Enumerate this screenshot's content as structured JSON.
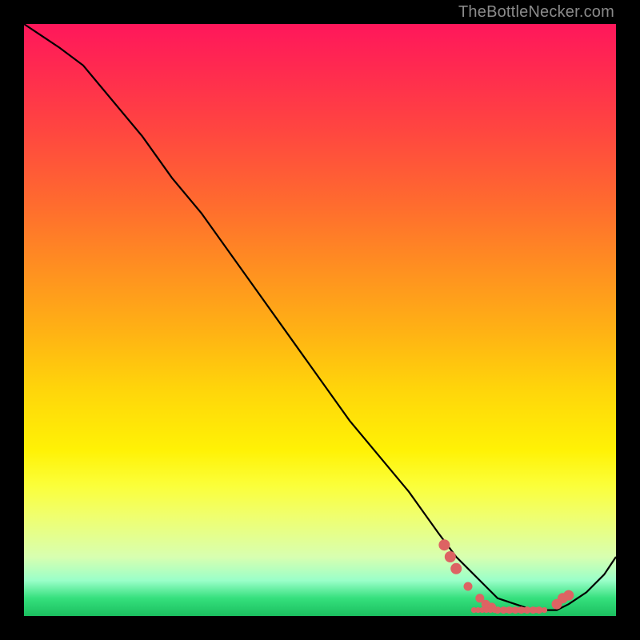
{
  "watermark": "TheBottleNecker.com",
  "chart_data": {
    "type": "line",
    "title": "",
    "xlabel": "",
    "ylabel": "",
    "xlim": [
      0,
      100
    ],
    "ylim": [
      0,
      100
    ],
    "grid": false,
    "series": [
      {
        "name": "curve",
        "x": [
          0,
          3,
          6,
          10,
          15,
          20,
          25,
          30,
          35,
          40,
          45,
          50,
          55,
          60,
          65,
          70,
          73,
          75,
          78,
          80,
          83,
          86,
          88,
          90,
          92,
          95,
          98,
          100
        ],
        "values": [
          100,
          98,
          96,
          93,
          87,
          81,
          74,
          68,
          61,
          54,
          47,
          40,
          33,
          27,
          21,
          14,
          10,
          8,
          5,
          3,
          2,
          1,
          1,
          1,
          2,
          4,
          7,
          10
        ]
      }
    ],
    "markers": {
      "name": "highlight-points",
      "x": [
        71,
        72,
        73,
        75,
        77,
        78,
        79,
        80,
        81,
        82,
        83,
        84,
        85,
        86,
        87,
        90,
        91,
        92
      ],
      "y": [
        12,
        10,
        8,
        5,
        3,
        2,
        1.5,
        1,
        1,
        1,
        1,
        1,
        1,
        1,
        1,
        2,
        3,
        3.5
      ],
      "color": "#dd6363"
    }
  }
}
